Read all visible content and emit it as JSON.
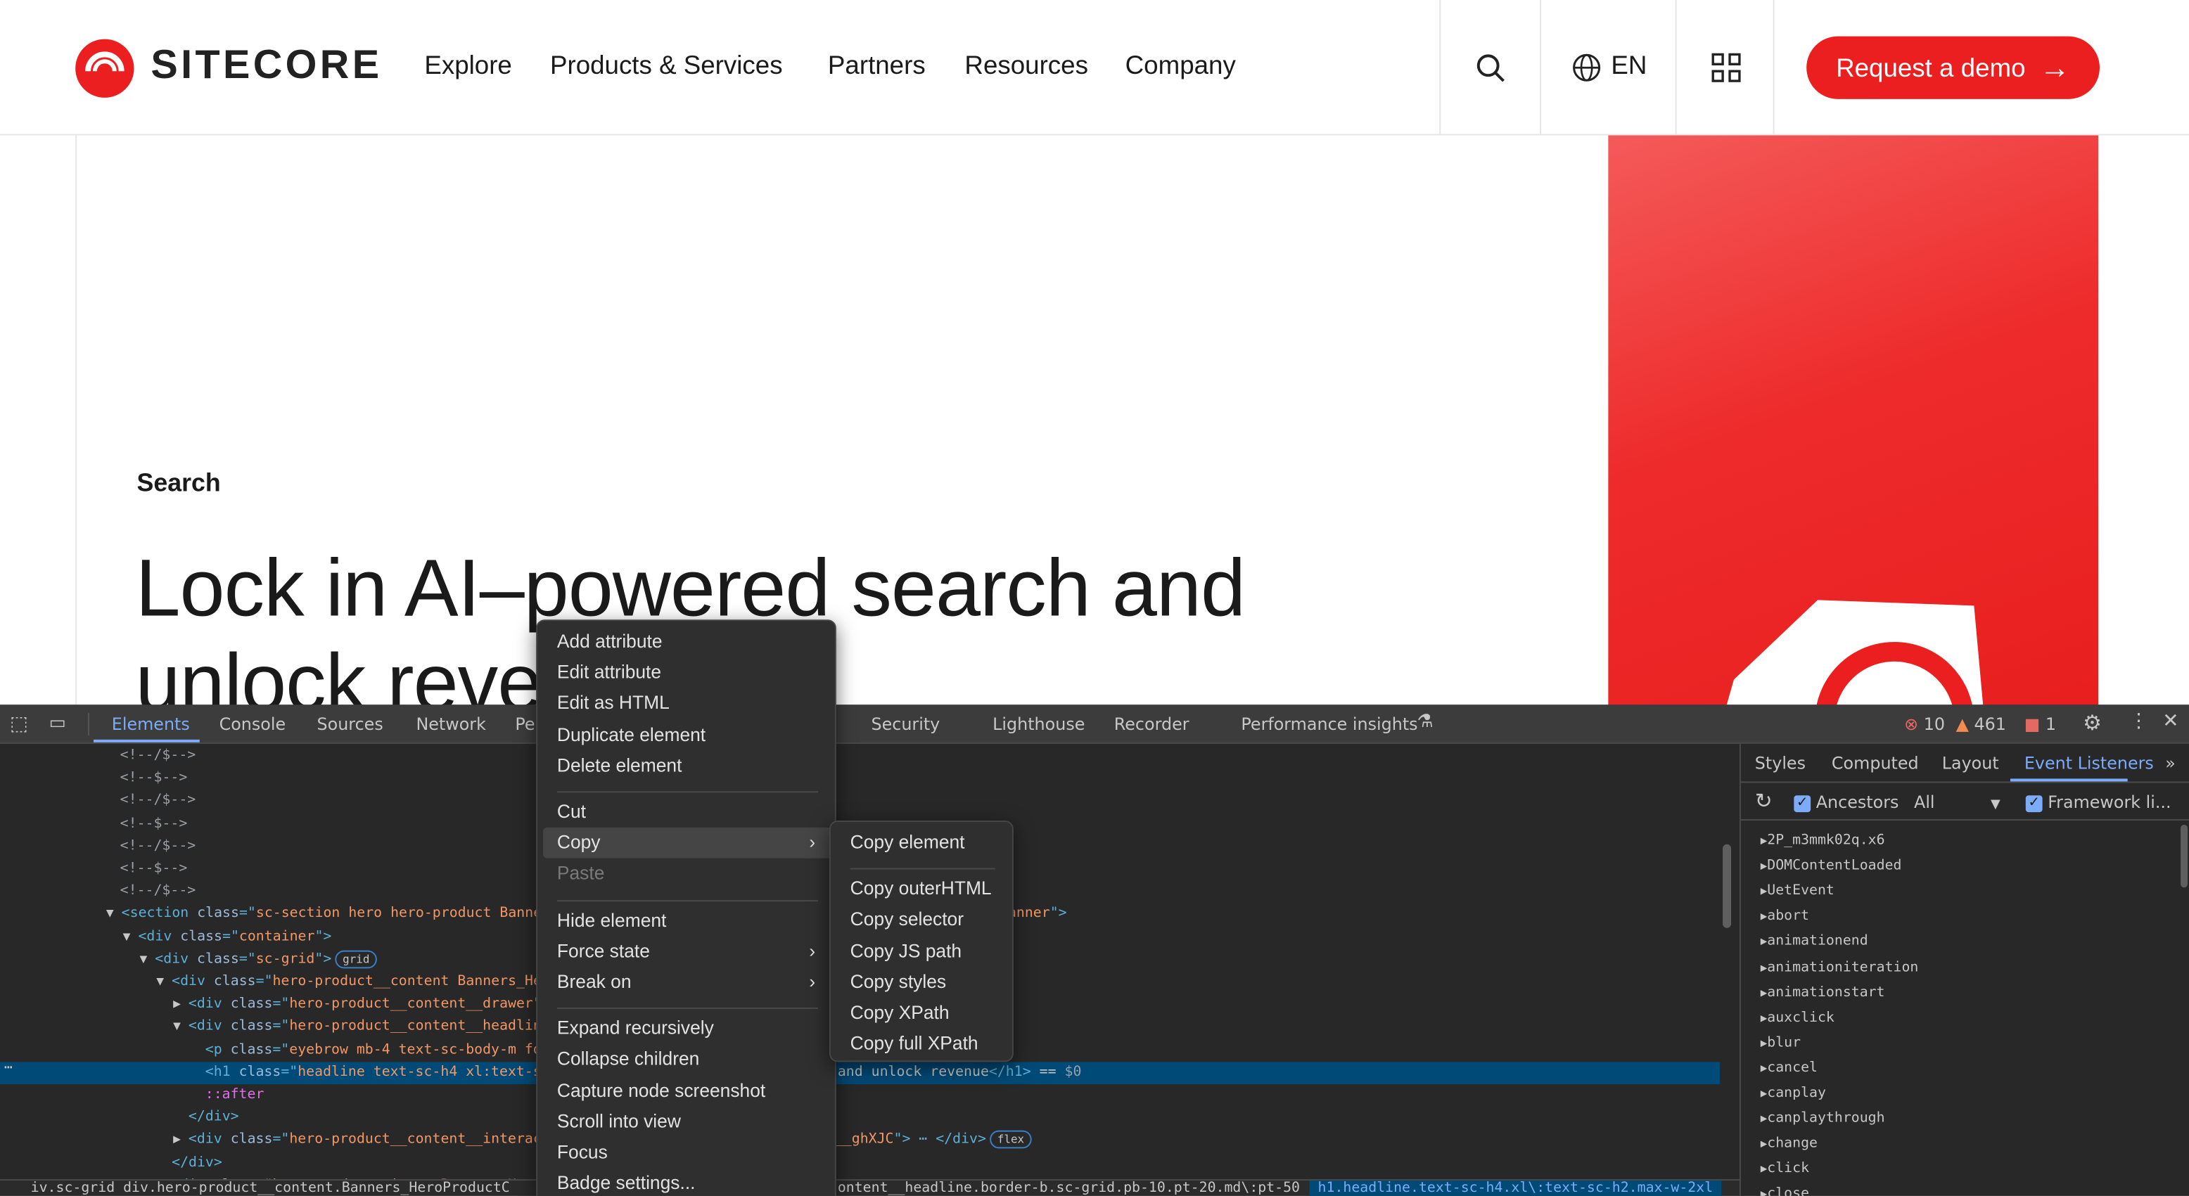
{
  "brand": {
    "name": "SITECORE",
    "accent": "#eb1f1f"
  },
  "nav": {
    "items": [
      "Explore",
      "Products & Services",
      "Partners",
      "Resources",
      "Company"
    ],
    "lang": "EN",
    "demo": "Request a demo"
  },
  "hero": {
    "eyebrow": "Search",
    "headline1": "Lock in AI–powered search and",
    "headline2": "unlock reve"
  },
  "devtools": {
    "tabs": [
      "Elements",
      "Console",
      "Sources",
      "Network",
      "Pe",
      "Security",
      "Lighthouse",
      "Recorder",
      "Performance insights"
    ],
    "errors": "10",
    "warnings": "461",
    "issues": "1",
    "right_tabs": [
      "Styles",
      "Computed",
      "Layout",
      "Event Listeners"
    ],
    "ancestors": "Ancestors",
    "filter": "All",
    "framework": "Framework li...",
    "listeners": [
      "2P_m3mmk02q.x6",
      "DOMContentLoaded",
      "UetEvent",
      "abort",
      "animationend",
      "animationiteration",
      "animationstart",
      "auxclick",
      "blur",
      "cancel",
      "canplay",
      "canplaythrough",
      "change",
      "click",
      "close"
    ],
    "dom": [
      {
        "i": 86,
        "t": [
          [
            "cm",
            "<!--/$-->"
          ]
        ]
      },
      {
        "i": 86,
        "t": [
          [
            "cm",
            "<!--$-->"
          ]
        ]
      },
      {
        "i": 86,
        "t": [
          [
            "cm",
            "<!--/$-->"
          ]
        ]
      },
      {
        "i": 86,
        "t": [
          [
            "cm",
            "<!--$-->"
          ]
        ]
      },
      {
        "i": 86,
        "t": [
          [
            "cm",
            "<!--/$-->"
          ]
        ]
      },
      {
        "i": 86,
        "t": [
          [
            "cm",
            "<!--$-->"
          ]
        ]
      },
      {
        "i": 86,
        "t": [
          [
            "cm",
            "<!--/$-->"
          ]
        ]
      },
      {
        "i": 87,
        "a": "▼",
        "t": [
          [
            "tag",
            "<section "
          ],
          [
            "an",
            "class"
          ],
          [
            "tag",
            "=\""
          ],
          [
            "av",
            "sc-section hero hero-product Banners_H"
          ]
        ],
        "r": [
          [
            "av",
            "anner"
          ],
          [
            "tag",
            "\">"
          ]
        ],
        "rx": 722
      },
      {
        "i": 99,
        "a": "▼",
        "t": [
          [
            "tag",
            "<div "
          ],
          [
            "an",
            "class"
          ],
          [
            "tag",
            "=\""
          ],
          [
            "av",
            "container"
          ],
          [
            "tag",
            "\">"
          ]
        ]
      },
      {
        "i": 111,
        "a": "▼",
        "t": [
          [
            "tag",
            "<div "
          ],
          [
            "an",
            "class"
          ],
          [
            "tag",
            "=\""
          ],
          [
            "av",
            "sc-grid"
          ],
          [
            "tag",
            "\">"
          ]
        ],
        "b": "grid"
      },
      {
        "i": 123,
        "a": "▼",
        "t": [
          [
            "tag",
            "<div "
          ],
          [
            "an",
            "class"
          ],
          [
            "tag",
            "=\""
          ],
          [
            "av",
            "hero-product__content Banners_HeroP"
          ]
        ]
      },
      {
        "i": 135,
        "a": "▶",
        "t": [
          [
            "tag",
            "<div "
          ],
          [
            "an",
            "class"
          ],
          [
            "tag",
            "=\""
          ],
          [
            "av",
            "hero-product__content__drawer"
          ],
          [
            "tag",
            "\">"
          ],
          [
            "tag",
            "⋯"
          ]
        ]
      },
      {
        "i": 135,
        "a": "▼",
        "t": [
          [
            "tag",
            "<div "
          ],
          [
            "an",
            "class"
          ],
          [
            "tag",
            "=\""
          ],
          [
            "av",
            "hero-product__content__headline b"
          ]
        ]
      },
      {
        "i": 147,
        "t": [
          [
            "tag",
            "<p "
          ],
          [
            "an",
            "class"
          ],
          [
            "tag",
            "=\""
          ],
          [
            "av",
            "eyebrow mb-4 text-sc-body-m font-"
          ]
        ]
      },
      {
        "i": 147,
        "s": true,
        "t": [
          [
            "tag",
            "<h1 "
          ],
          [
            "an",
            "class"
          ],
          [
            "tag",
            "=\""
          ],
          [
            "av",
            "headline text-sc-h4 xl:text-sc-h"
          ]
        ],
        "r": [
          [
            "",
            "and unlock revenue"
          ],
          [
            "tag",
            "</h1>"
          ],
          [
            "",
            " == "
          ],
          [
            "cm",
            "$0"
          ]
        ],
        "rx": 600
      },
      {
        "i": 147,
        "t": [
          [
            "ps",
            "::after"
          ]
        ]
      },
      {
        "i": 135,
        "t": [
          [
            "tag",
            "</div>"
          ]
        ]
      },
      {
        "i": 135,
        "a": "▶",
        "t": [
          [
            "tag",
            "<div "
          ],
          [
            "an",
            "class"
          ],
          [
            "tag",
            "=\""
          ],
          [
            "av",
            "hero-product__content__interactiv"
          ]
        ],
        "r": [
          [
            "av",
            "__ghXJC"
          ],
          [
            "tag",
            "\"> ⋯ </div>"
          ]
        ],
        "rx": 598,
        "rb": "flex"
      },
      {
        "i": 123,
        "t": [
          [
            "tag",
            "</div>"
          ]
        ]
      },
      {
        "i": 123,
        "a": "▶",
        "t": [
          [
            "tag",
            "<div "
          ],
          [
            "an",
            "class"
          ],
          [
            "tag",
            "=\""
          ],
          [
            "av",
            "hero-product__image Banners_HeroPro"
          ]
        ]
      }
    ],
    "breadcrumb": [
      "iv.sc-grid  div.hero-product__content.Banners_HeroProductC",
      "ontent__headline.border-b.sc-grid.pb-10.pt-20.md\\:pt-50",
      "h1.headline.text-sc-h4.xl\\:text-sc-h2.max-w-2xl"
    ],
    "context_menu": [
      {
        "l": "Add attribute"
      },
      {
        "l": "Edit attribute"
      },
      {
        "l": "Edit as HTML"
      },
      {
        "l": "Duplicate element"
      },
      {
        "l": "Delete element"
      },
      {
        "sep": true
      },
      {
        "l": "Cut"
      },
      {
        "l": "Copy",
        "sub": true,
        "hl": true
      },
      {
        "l": "Paste",
        "dis": true
      },
      {
        "sep": true
      },
      {
        "l": "Hide element"
      },
      {
        "l": "Force state",
        "sub": true
      },
      {
        "l": "Break on",
        "sub": true
      },
      {
        "sep": true
      },
      {
        "l": "Expand recursively"
      },
      {
        "l": "Collapse children"
      },
      {
        "l": "Capture node screenshot"
      },
      {
        "l": "Scroll into view"
      },
      {
        "l": "Focus"
      },
      {
        "l": "Badge settings..."
      }
    ],
    "copy_submenu": [
      {
        "l": "Copy element"
      },
      {
        "sep": true
      },
      {
        "l": "Copy outerHTML"
      },
      {
        "l": "Copy selector"
      },
      {
        "l": "Copy JS path"
      },
      {
        "l": "Copy styles"
      },
      {
        "l": "Copy XPath"
      },
      {
        "l": "Copy full XPath"
      }
    ]
  }
}
